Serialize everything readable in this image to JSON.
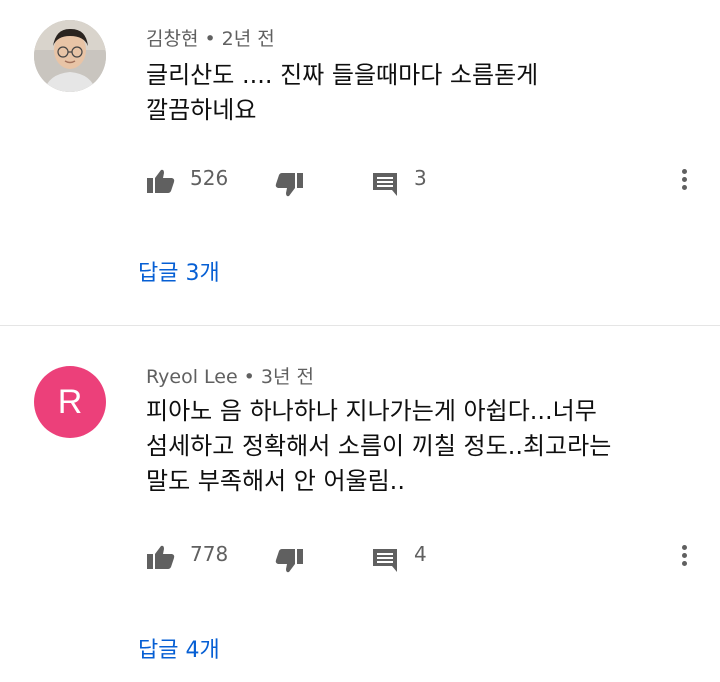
{
  "comments": [
    {
      "author": "김창현",
      "separator": "•",
      "time": "2년 전",
      "text": "글리산도 .... 진짜 들을때마다 소름돋게\n깔끔하네요",
      "likes": "526",
      "reply_count": "3",
      "replies_label": "답글 3개",
      "avatar": {
        "type": "photo",
        "color": "#c9c5bf"
      }
    },
    {
      "author": "Ryeol Lee",
      "separator": "•",
      "time": "3년 전",
      "text": "피아노 음 하나하나 지나가는게 아쉽다...너무\n섬세하고 정확해서 소름이 끼칠 정도..최고라는\n말도 부족해서 안 어울림..",
      "likes": "778",
      "reply_count": "4",
      "replies_label": "답글 4개",
      "avatar": {
        "type": "letter",
        "letter": "R",
        "color": "#ec407a"
      }
    }
  ],
  "icons": {
    "like": "thumbs-up-icon",
    "dislike": "thumbs-down-icon",
    "reply": "comment-icon",
    "more": "more-vertical-icon"
  },
  "colors": {
    "link": "#065fd4",
    "secondary_text": "#606060",
    "icon": "#606060"
  }
}
